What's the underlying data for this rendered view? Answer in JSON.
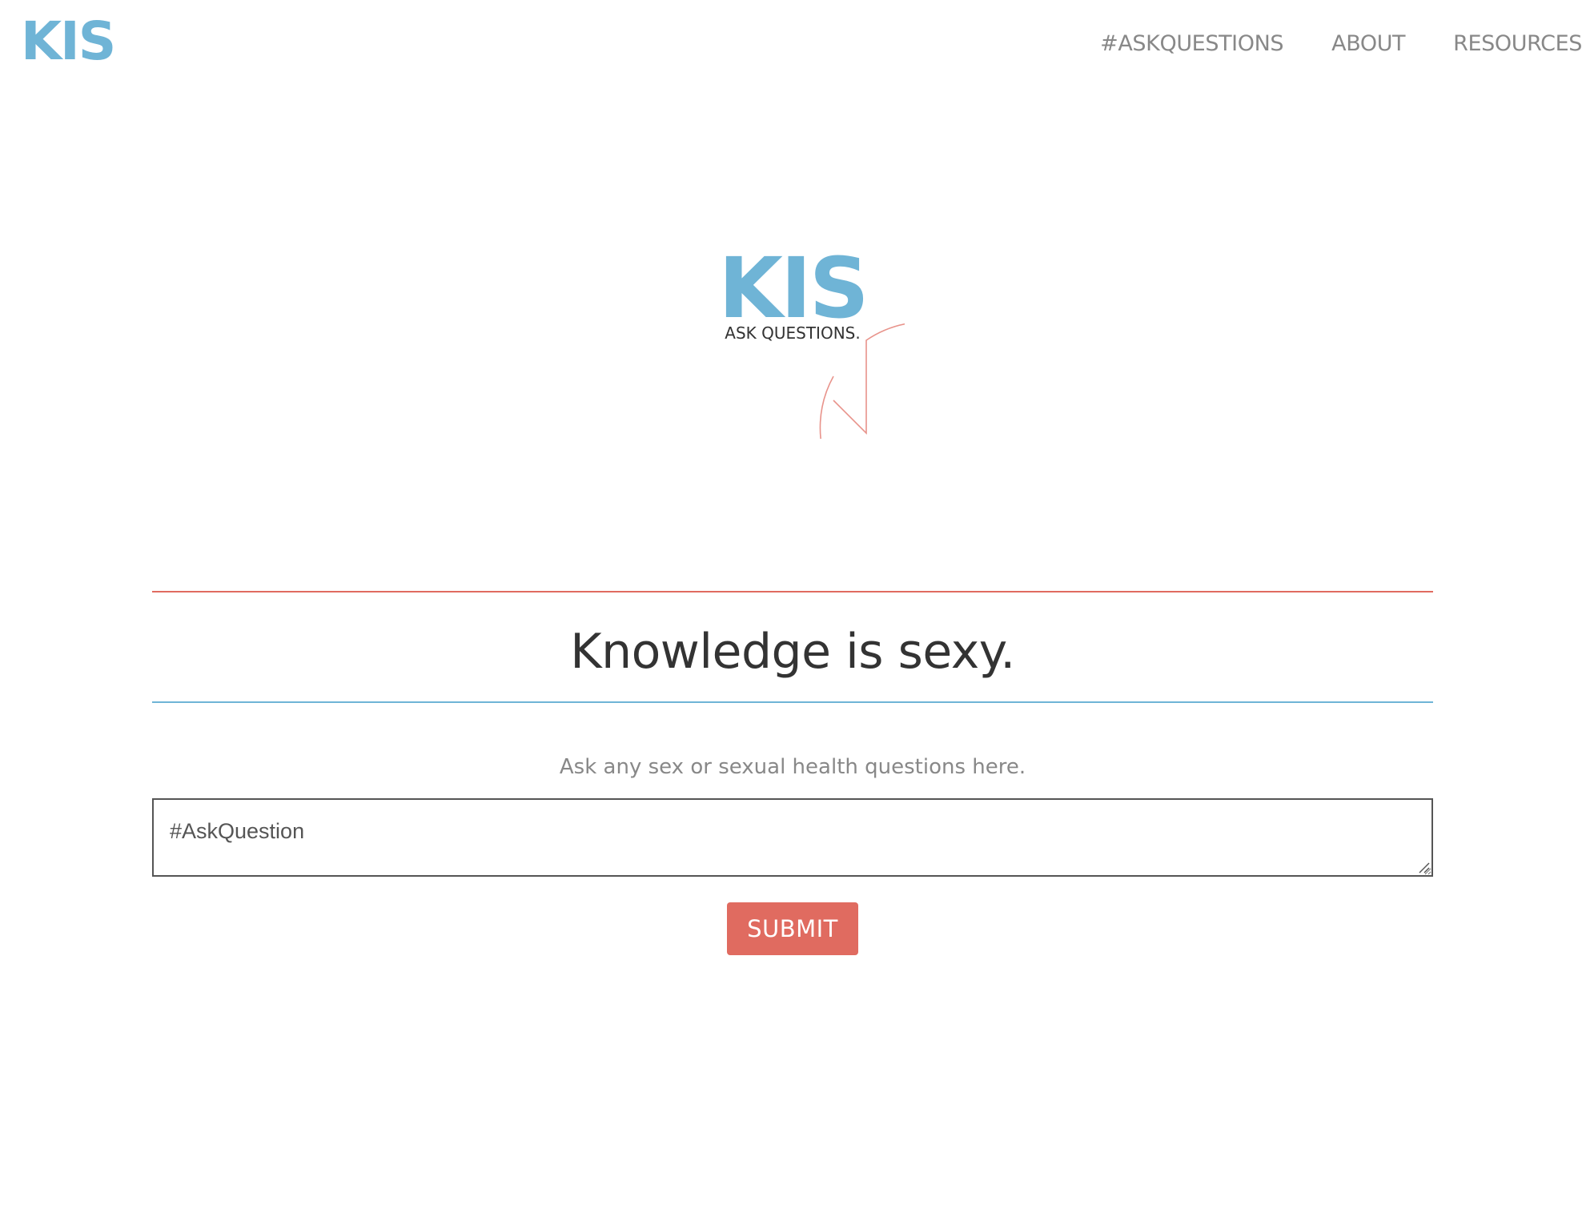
{
  "colors": {
    "brand_blue": "#6fb4d6",
    "accent_red": "#e06b60",
    "nav_text": "#888888",
    "headline_text": "#333333",
    "subtext": "#888888",
    "rule_top": "#e06b60",
    "rule_bottom": "#6fb4d6",
    "badge_outline": "#e8938b",
    "button_text": "#ffffff"
  },
  "nav": {
    "logo": "KIS",
    "links": [
      {
        "label": "#ASKQUESTIONS"
      },
      {
        "label": "ABOUT"
      },
      {
        "label": "RESOURCES"
      }
    ]
  },
  "badge": {
    "title": "KIS",
    "tagline": "ASK QUESTIONS."
  },
  "main": {
    "headline": "Knowledge is sexy.",
    "subtext": "Ask any sex or sexual health questions here.",
    "question_placeholder": "#AskQuestion",
    "question_value": "",
    "submit_label": "SUBMIT"
  }
}
